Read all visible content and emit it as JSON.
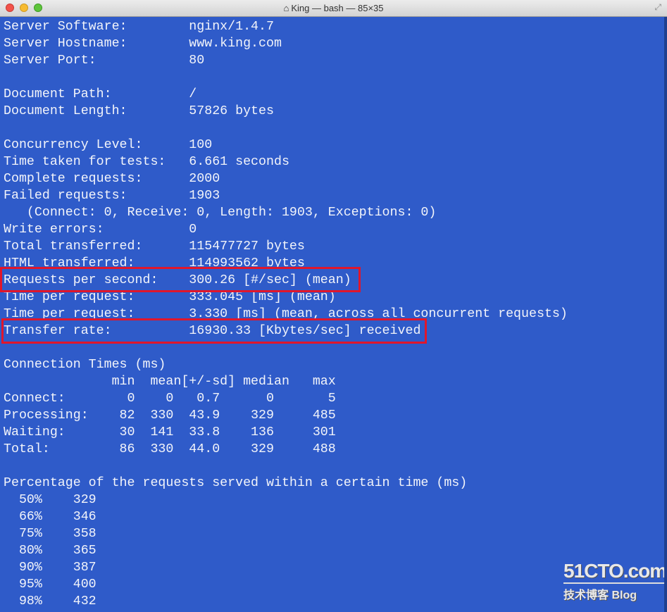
{
  "window": {
    "title": "King — bash — 85×35",
    "home_icon": "home-icon"
  },
  "terminal": {
    "background": "#2f5bc9",
    "highlight_color": "#e0162b",
    "lines": [
      "Server Software:        nginx/1.4.7",
      "Server Hostname:        www.king.com",
      "Server Port:            80",
      "",
      "Document Path:          /",
      "Document Length:        57826 bytes",
      "",
      "Concurrency Level:      100",
      "Time taken for tests:   6.661 seconds",
      "Complete requests:      2000",
      "Failed requests:        1903",
      "   (Connect: 0, Receive: 0, Length: 1903, Exceptions: 0)",
      "Write errors:           0",
      "Total transferred:      115477727 bytes",
      "HTML transferred:       114993562 bytes",
      "Requests per second:    300.26 [#/sec] (mean)",
      "Time per request:       333.045 [ms] (mean)",
      "Time per request:       3.330 [ms] (mean, across all concurrent requests)",
      "Transfer rate:          16930.33 [Kbytes/sec] received",
      "",
      "Connection Times (ms)",
      "              min  mean[+/-sd] median   max",
      "Connect:        0    0   0.7      0       5",
      "Processing:    82  330  43.9    329     485",
      "Waiting:       30  141  33.8    136     301",
      "Total:         86  330  44.0    329     488",
      "",
      "Percentage of the requests served within a certain time (ms)",
      "  50%    329",
      "  66%    346",
      "  75%    358",
      "  80%    365",
      "  90%    387",
      "  95%    400",
      "  98%    432"
    ],
    "highlighted_lines": [
      15,
      18
    ]
  },
  "watermark": {
    "line1": "51CTO.com",
    "line2": "技术博客 Blog"
  }
}
